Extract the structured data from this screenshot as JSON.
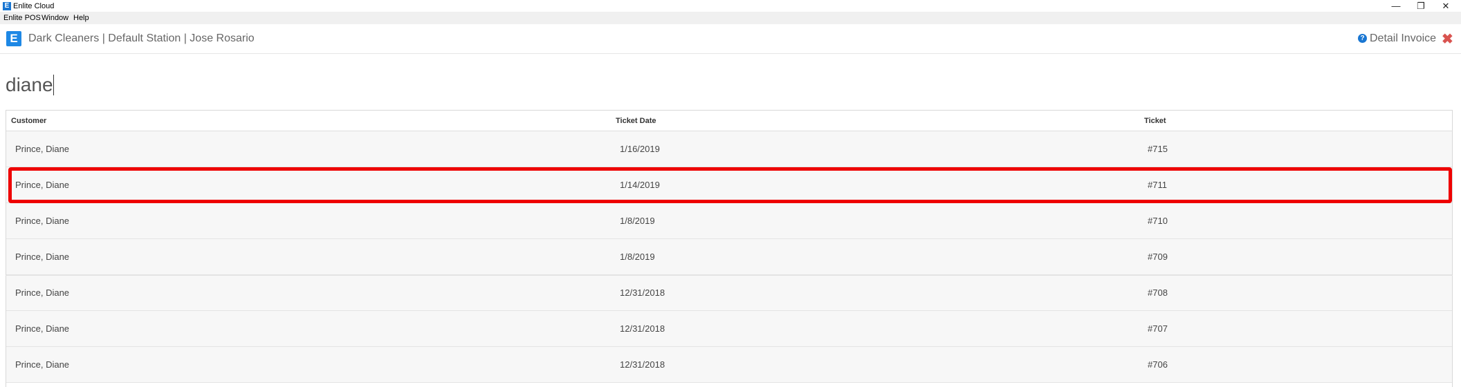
{
  "window": {
    "title": "Enlite Cloud",
    "logo_letter": "E",
    "controls": {
      "minimize": "—",
      "restore": "❐",
      "close": "✕"
    }
  },
  "menubar": {
    "items": [
      "Enlite POS",
      "Window",
      "Help"
    ]
  },
  "header": {
    "logo_letter": "E",
    "title": "Dark Cleaners | Default Station | Jose Rosario",
    "help_icon": "?",
    "detail_invoice": "Detail Invoice",
    "close_icon": "✖"
  },
  "search": {
    "value": "diane"
  },
  "table": {
    "columns": [
      "Customer",
      "Ticket Date",
      "Ticket"
    ],
    "rows": [
      {
        "customer": "Prince, Diane",
        "date": "1/16/2019",
        "ticket": "#715"
      },
      {
        "customer": "Prince, Diane",
        "date": "1/14/2019",
        "ticket": "#711"
      },
      {
        "customer": "Prince, Diane",
        "date": "1/8/2019",
        "ticket": "#710"
      },
      {
        "customer": "Prince, Diane",
        "date": "1/8/2019",
        "ticket": "#709"
      },
      {
        "customer": "Prince, Diane",
        "date": "12/31/2018",
        "ticket": "#708"
      },
      {
        "customer": "Prince, Diane",
        "date": "12/31/2018",
        "ticket": "#707"
      },
      {
        "customer": "Prince, Diane",
        "date": "12/31/2018",
        "ticket": "#706"
      }
    ],
    "highlighted_row_index": 1
  },
  "colors": {
    "accent": "#1976d2",
    "highlight": "#ee0000",
    "close": "#d9534f"
  }
}
